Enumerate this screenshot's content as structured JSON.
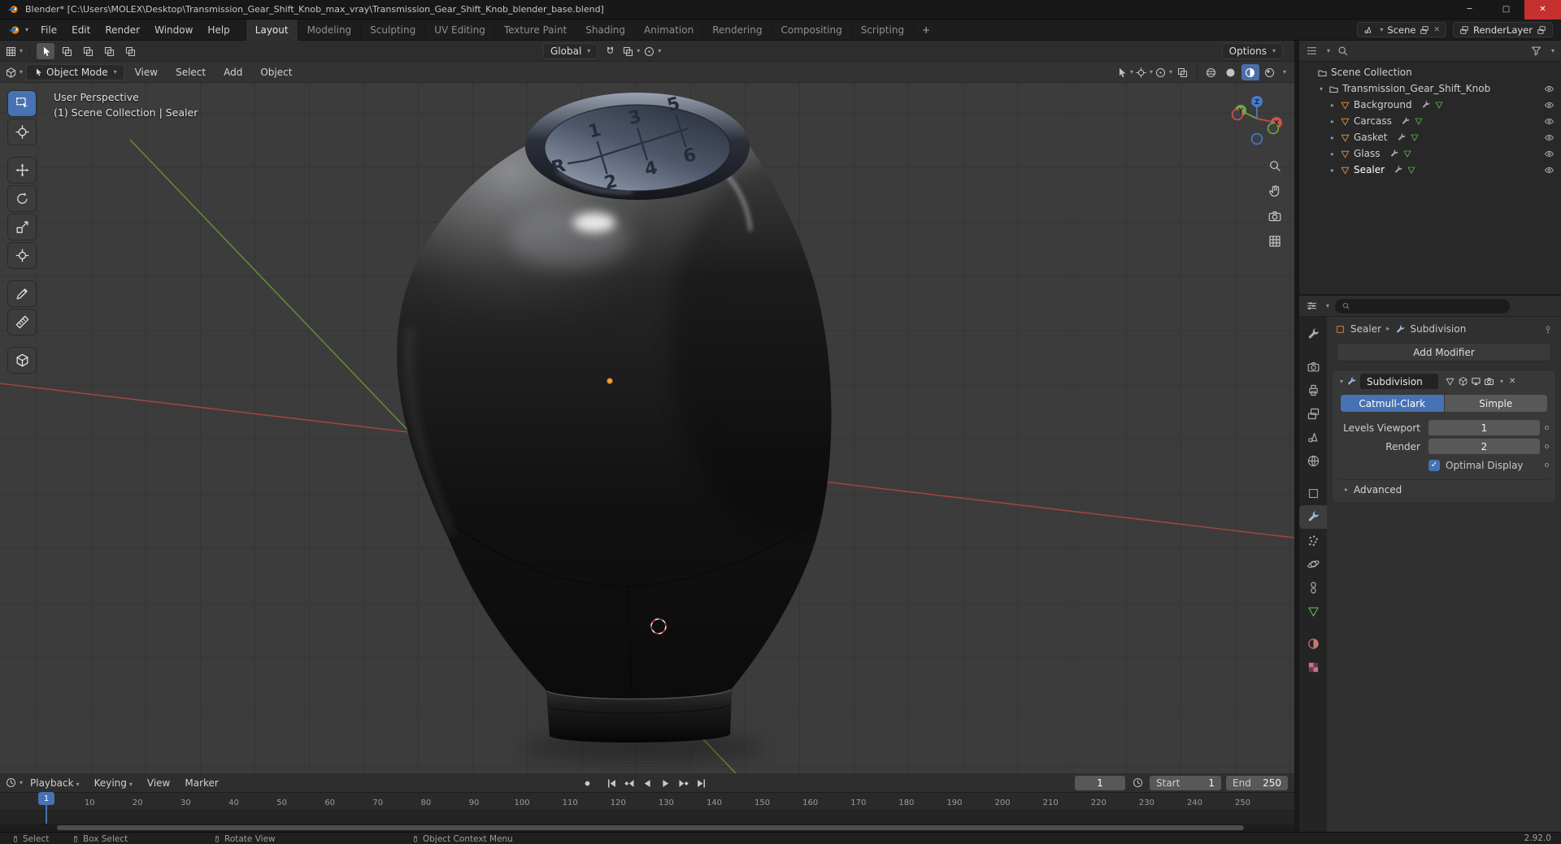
{
  "window": {
    "title": "Blender* [C:\\Users\\MOLEX\\Desktop\\Transmission_Gear_Shift_Knob_max_vray\\Transmission_Gear_Shift_Knob_blender_base.blend]",
    "controls": {
      "minimize": "─",
      "maximize": "□",
      "close": "✕"
    }
  },
  "topbar": {
    "menus": [
      "File",
      "Edit",
      "Render",
      "Window",
      "Help"
    ],
    "workspaces": [
      "Layout",
      "Modeling",
      "Sculpting",
      "UV Editing",
      "Texture Paint",
      "Shading",
      "Animation",
      "Rendering",
      "Compositing",
      "Scripting"
    ],
    "active_workspace": "Layout",
    "add_workspace": "+",
    "scene": "Scene",
    "view_layer": "RenderLayer"
  },
  "tool_settings": {
    "orientation": "Global",
    "options": "Options"
  },
  "view_header": {
    "mode": "Object Mode",
    "menus": [
      "View",
      "Select",
      "Add",
      "Object"
    ]
  },
  "viewport": {
    "overlay_line1": "User Perspective",
    "overlay_line2": "(1) Scene Collection | Sealer",
    "gizmo_axes": [
      "X",
      "Y",
      "Z"
    ],
    "shift_pattern": {
      "r": "R",
      "g1": "1",
      "g2": "2",
      "g3": "3",
      "g4": "4",
      "g5": "5",
      "g6": "6"
    }
  },
  "outliner": {
    "root": "Scene Collection",
    "collection": "Transmission_Gear_Shift_Knob",
    "objects": [
      "Background",
      "Carcass",
      "Gasket",
      "Glass",
      "Sealer"
    ]
  },
  "properties": {
    "breadcrumb_object": "Sealer",
    "breadcrumb_modifier": "Subdivision",
    "add_modifier": "Add Modifier",
    "modifier_name": "Subdivision",
    "type_left": "Catmull-Clark",
    "type_right": "Simple",
    "levels_viewport_label": "Levels Viewport",
    "levels_viewport_value": "1",
    "render_label": "Render",
    "render_value": "2",
    "optimal_display": "Optimal Display",
    "optimal_display_checked": true,
    "advanced": "Advanced"
  },
  "timeline": {
    "menus": [
      "Playback",
      "Keying",
      "View",
      "Marker"
    ],
    "current_frame": 1,
    "start_label": "Start",
    "start_value": "1",
    "end_label": "End",
    "end_value": "250",
    "ruler_frames": [
      10,
      20,
      30,
      40,
      50,
      60,
      70,
      80,
      90,
      100,
      110,
      120,
      130,
      140,
      150,
      160,
      170,
      180,
      190,
      200,
      210,
      220,
      230,
      240,
      250
    ]
  },
  "statusbar": {
    "items": [
      "Select",
      "Box Select",
      "Rotate View",
      "Object Context Menu"
    ],
    "version": "2.92.0"
  },
  "colors": {
    "accent": "#4772b3",
    "axis_x": "#a94742",
    "axis_y": "#6a8f38",
    "object_orange": "#dd8a3a",
    "mesh_green": "#58b04c"
  }
}
